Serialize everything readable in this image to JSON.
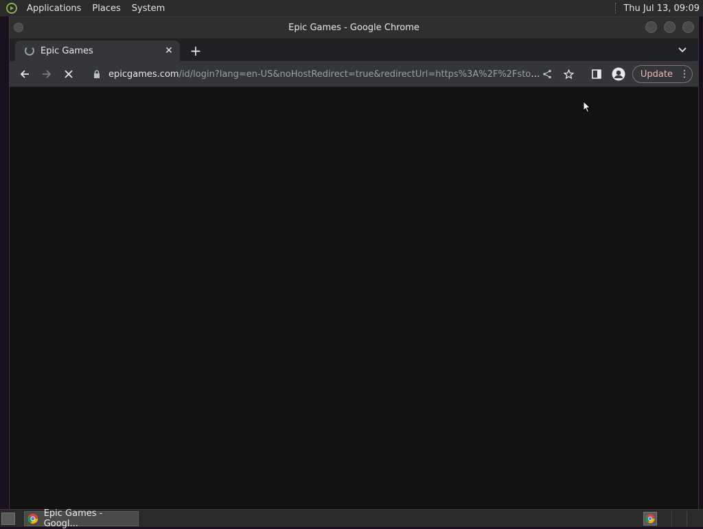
{
  "top_panel": {
    "menus": [
      "Applications",
      "Places",
      "System"
    ],
    "clock": "Thu Jul 13, 09:09"
  },
  "window": {
    "title": "Epic Games - Google Chrome"
  },
  "tabs": [
    {
      "label": "Epic Games",
      "loading": true
    }
  ],
  "omnibox": {
    "url_host": "epicgames.com",
    "url_rest": "/id/login?lang=en-US&noHostRedirect=true&redirectUrl=https%3A%2F%2Fstore.e..."
  },
  "toolbar": {
    "update_label": "Update"
  },
  "taskbar": {
    "task_label": "Epic Games - Googl..."
  },
  "colors": {
    "page_bg": "#121212",
    "update_text": "#f2b8b5"
  }
}
